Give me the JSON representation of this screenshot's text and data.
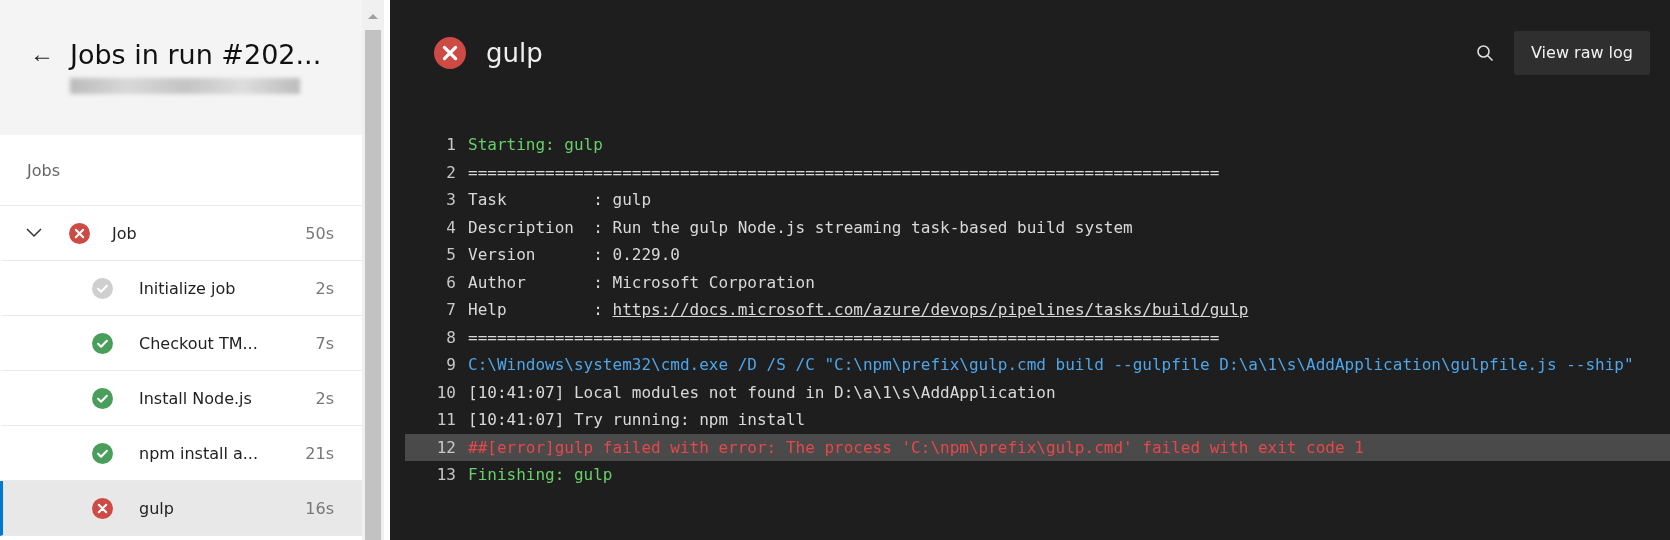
{
  "sidebar": {
    "back": "←",
    "title": "Jobs in run #202...",
    "section_label": "Jobs",
    "jobs": [
      {
        "name": "Job",
        "duration": "50s",
        "kind": "failed",
        "expanded": true,
        "selected": false,
        "children": [
          {
            "name": "Initialize job",
            "duration": "2s",
            "kind": "skipped",
            "selected": false
          },
          {
            "name": "Checkout TM...",
            "duration": "7s",
            "kind": "succeeded",
            "selected": false
          },
          {
            "name": "Install Node.js",
            "duration": "2s",
            "kind": "succeeded",
            "selected": false
          },
          {
            "name": "npm install a...",
            "duration": "21s",
            "kind": "succeeded",
            "selected": false
          },
          {
            "name": "gulp",
            "duration": "16s",
            "kind": "failed",
            "selected": true
          }
        ]
      }
    ]
  },
  "log": {
    "title": "gulp",
    "kind": "failed",
    "raw_log_button": "View raw log",
    "lines": [
      {
        "number": "1",
        "kind": "section",
        "text": "Starting: gulp",
        "selected": false
      },
      {
        "number": "2",
        "kind": "plain",
        "text": "==============================================================================",
        "selected": false
      },
      {
        "number": "3",
        "kind": "plain",
        "text": "Task         : gulp",
        "selected": false
      },
      {
        "number": "4",
        "kind": "plain",
        "text": "Description  : Run the gulp Node.js streaming task-based build system",
        "selected": false
      },
      {
        "number": "5",
        "kind": "plain",
        "text": "Version      : 0.229.0",
        "selected": false
      },
      {
        "number": "6",
        "kind": "plain",
        "text": "Author       : Microsoft Corporation",
        "selected": false
      },
      {
        "number": "7",
        "kind": "plain",
        "text": "Help         : ",
        "link": "https://docs.microsoft.com/azure/devops/pipelines/tasks/build/gulp",
        "selected": false
      },
      {
        "number": "8",
        "kind": "plain",
        "text": "==============================================================================",
        "selected": false
      },
      {
        "number": "9",
        "kind": "command",
        "text": "C:\\Windows\\system32\\cmd.exe /D /S /C \"C:\\npm\\prefix\\gulp.cmd build --gulpfile D:\\a\\1\\s\\AddApplication\\gulpfile.js --ship\"",
        "selected": false
      },
      {
        "number": "10",
        "kind": "plain",
        "text": "[10:41:07] Local modules not found in D:\\a\\1\\s\\AddApplication",
        "selected": false
      },
      {
        "number": "11",
        "kind": "plain",
        "text": "[10:41:07] Try running: npm install",
        "selected": false
      },
      {
        "number": "12",
        "kind": "error",
        "text": "##[error]gulp failed with error: The process 'C:\\npm\\prefix\\gulp.cmd' failed with exit code 1",
        "selected": true
      },
      {
        "number": "13",
        "kind": "section",
        "text": "Finishing: gulp",
        "selected": false
      }
    ]
  }
}
